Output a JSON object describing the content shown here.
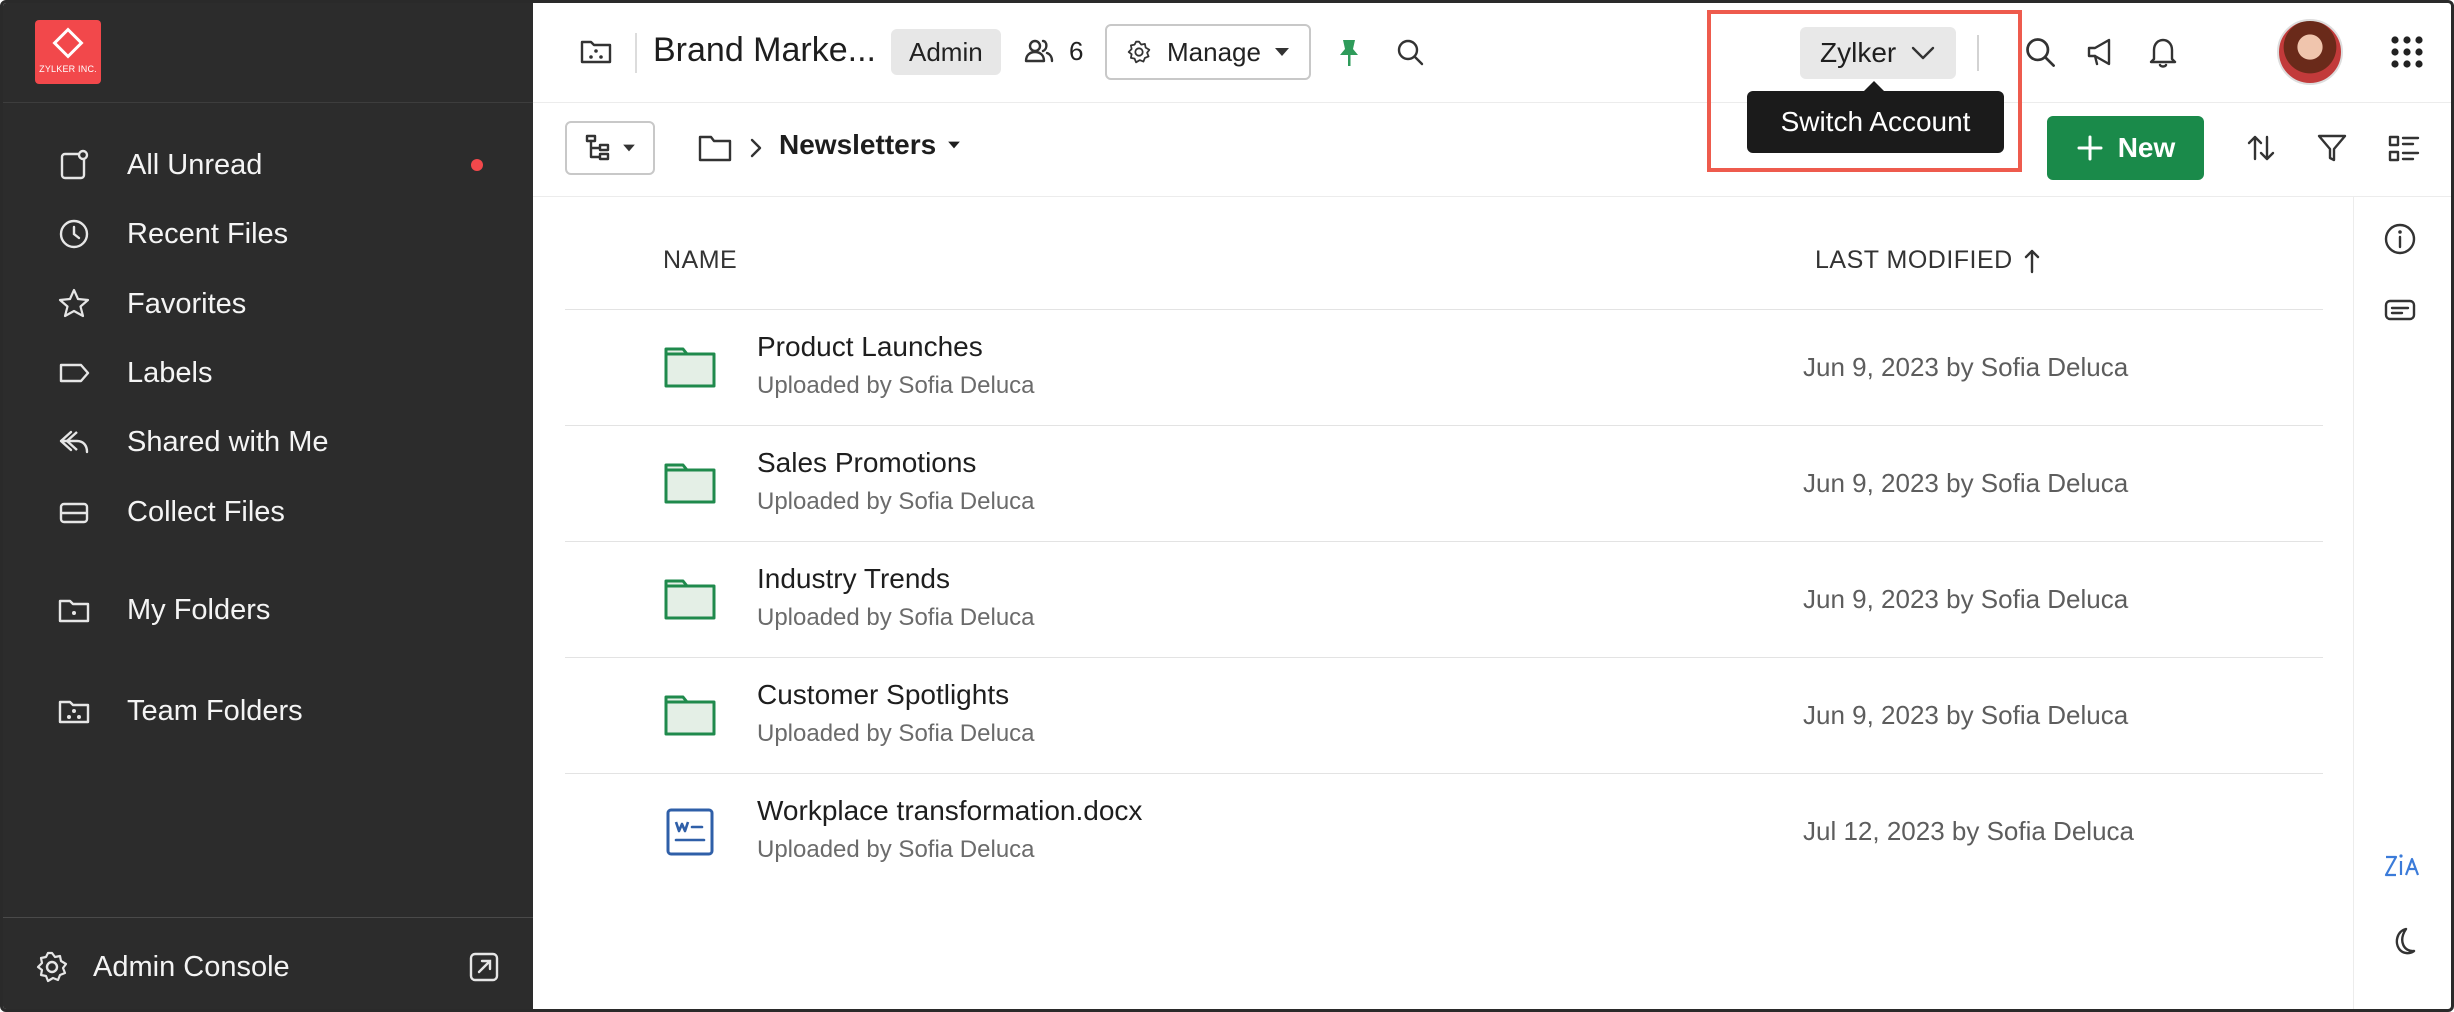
{
  "sidebar": {
    "logo_text": "ZYLKER INC.",
    "items": [
      {
        "label": "All Unread",
        "icon": "unread-icon",
        "unread": true
      },
      {
        "label": "Recent Files",
        "icon": "clock-icon"
      },
      {
        "label": "Favorites",
        "icon": "star-icon"
      },
      {
        "label": "Labels",
        "icon": "label-icon"
      },
      {
        "label": "Shared with Me",
        "icon": "share-icon"
      },
      {
        "label": "Collect Files",
        "icon": "inbox-icon"
      },
      {
        "label": "My Folders",
        "icon": "folder-icon"
      },
      {
        "label": "Team Folders",
        "icon": "team-folder-icon"
      }
    ],
    "footer": {
      "label": "Admin Console",
      "icon": "gear-icon"
    }
  },
  "header": {
    "workspace_title": "Brand Marke...",
    "role_badge": "Admin",
    "member_count": "6",
    "manage_label": "Manage",
    "account_label": "Zylker",
    "tooltip": "Switch Account"
  },
  "toolbar": {
    "breadcrumb_current": "Newsletters",
    "new_label": "New"
  },
  "list": {
    "columns": {
      "name": "NAME",
      "modified": "LAST MODIFIED"
    },
    "rows": [
      {
        "name": "Product Launches",
        "sub": "Uploaded by Sofia Deluca",
        "modified": "Jun 9, 2023 by Sofia Deluca",
        "type": "folder"
      },
      {
        "name": "Sales Promotions",
        "sub": "Uploaded by Sofia Deluca",
        "modified": "Jun 9, 2023 by Sofia Deluca",
        "type": "folder"
      },
      {
        "name": "Industry Trends",
        "sub": "Uploaded by Sofia Deluca",
        "modified": "Jun 9, 2023 by Sofia Deluca",
        "type": "folder"
      },
      {
        "name": "Customer Spotlights",
        "sub": "Uploaded by Sofia Deluca",
        "modified": "Jun 9, 2023 by Sofia Deluca",
        "type": "folder"
      },
      {
        "name": "Workplace transformation.docx",
        "sub": "Uploaded by Sofia Deluca",
        "modified": "Jul 12, 2023 by Sofia Deluca",
        "type": "docx"
      }
    ]
  },
  "colors": {
    "sidebar_bg": "#2c2c2c",
    "accent_green": "#1a8a4a",
    "brand_red": "#f2484b",
    "highlight": "#ee5b4d"
  }
}
